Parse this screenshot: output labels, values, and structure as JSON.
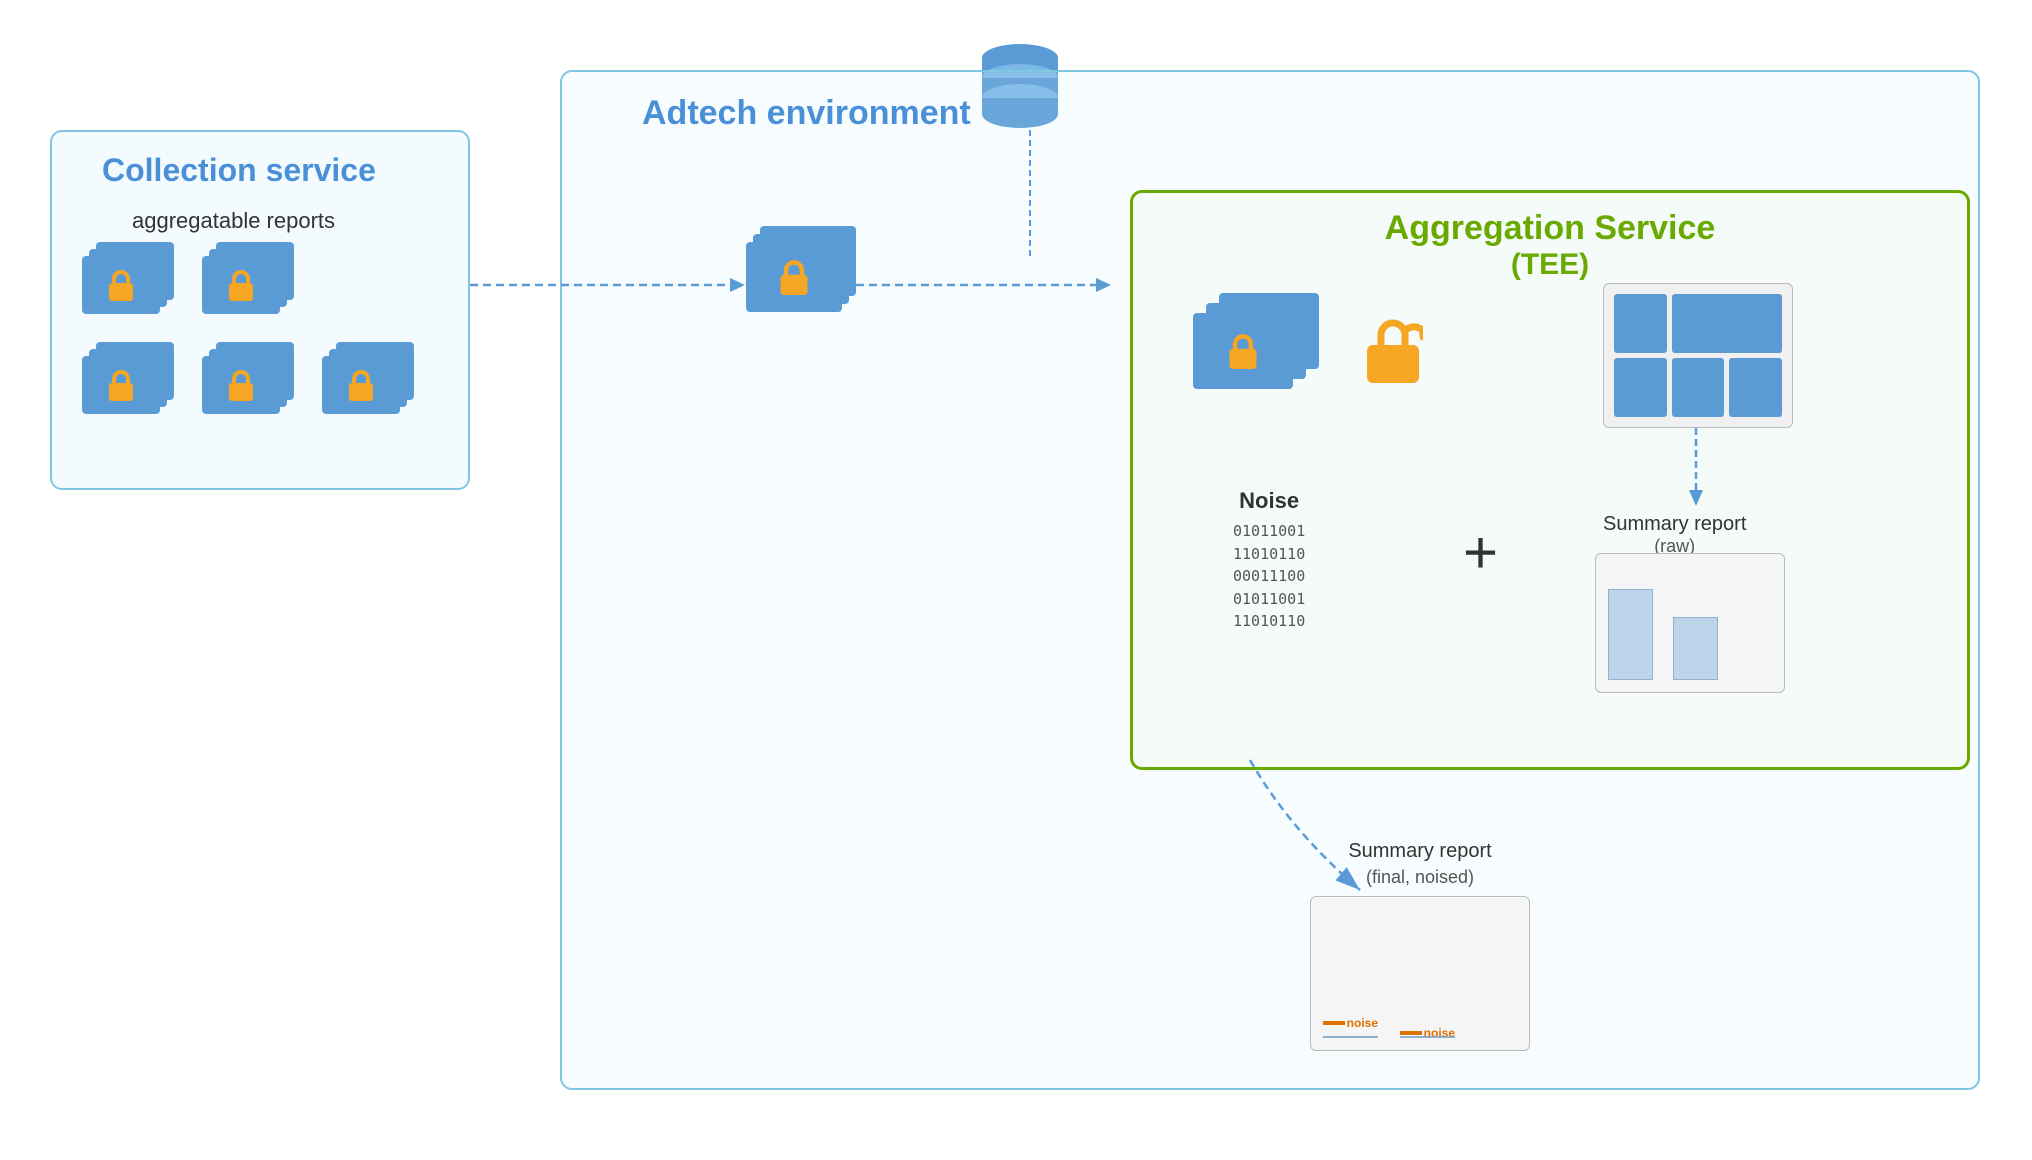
{
  "adtech": {
    "env_label": "Adtech environment",
    "aggregation_service_label": "Aggregation Service",
    "aggregation_service_sublabel": "(TEE)"
  },
  "collection_service": {
    "label": "Collection service",
    "reports_label": "aggregatable reports"
  },
  "noise": {
    "label": "Noise",
    "binary_lines": [
      "01011001",
      "11010110",
      "00011100",
      "01011001",
      "11010110"
    ]
  },
  "summary_report_raw": {
    "label": "Summary report",
    "sublabel": "(raw)"
  },
  "summary_report_final": {
    "label": "Summary report",
    "sublabel": "(final, noised)"
  },
  "noise_bar_labels": [
    "noise",
    "noise"
  ],
  "colors": {
    "blue_border": "#7ec8e3",
    "green_border": "#6aaa00",
    "accent_blue": "#4a90d9",
    "doc_blue": "#5b9bd5",
    "lock_orange": "#f5a623",
    "noise_orange": "#e07000"
  }
}
